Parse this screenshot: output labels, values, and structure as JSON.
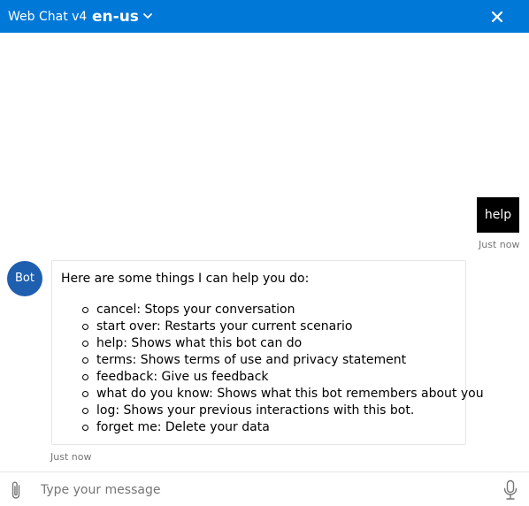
{
  "header": {
    "title": "Web Chat v4",
    "language": "en-us",
    "icons": {
      "language_dropdown": "chevron-down-icon",
      "close": "close-icon"
    },
    "background_color": "#0078d7"
  },
  "conversation": {
    "user_message": {
      "text": "help",
      "timestamp": "Just now"
    },
    "bot_message": {
      "avatar_initials": "Bot",
      "intro": "Here are some things I can help you do:",
      "commands": [
        "cancel: Stops your conversation",
        "start over: Restarts your current scenario",
        "help: Shows what this bot can do",
        "terms: Shows terms of use and privacy statement",
        "feedback: Give us feedback",
        "what do you know: Shows what this bot remembers about you",
        "log: Shows your previous interactions with this bot.",
        "forget me: Delete your data"
      ],
      "timestamp": "Just now"
    }
  },
  "composer": {
    "placeholder": "Type your message",
    "value": "",
    "icons": {
      "attach": "paperclip-icon",
      "microphone": "microphone-icon"
    }
  },
  "colors": {
    "accent": "#0078d7",
    "user_bubble": "#000000",
    "bot_avatar": "#1f5fb0",
    "timestamp": "#767676"
  }
}
